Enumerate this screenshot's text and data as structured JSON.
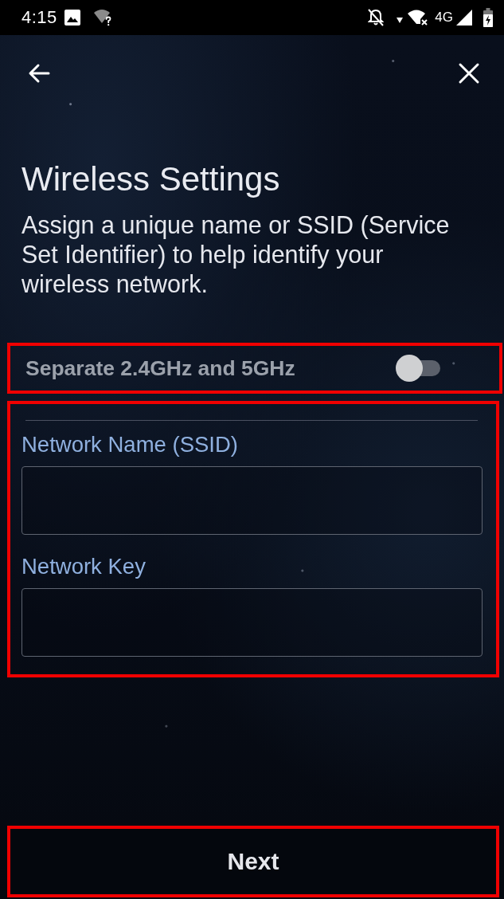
{
  "status_bar": {
    "time": "4:15",
    "network_type": "4G"
  },
  "title": "Wireless Settings",
  "description": "Assign a unique name or SSID (Service Set Identifier) to help identify your wireless network.",
  "toggle_row": {
    "label": "Separate 2.4GHz and 5GHz",
    "on": false,
    "highlighted": true
  },
  "fields_section": {
    "highlighted": true,
    "fields": [
      {
        "label": "Network Name (SSID)"
      },
      {
        "label": "Network Key"
      }
    ]
  },
  "next_button": {
    "label": "Next",
    "highlighted": true
  }
}
